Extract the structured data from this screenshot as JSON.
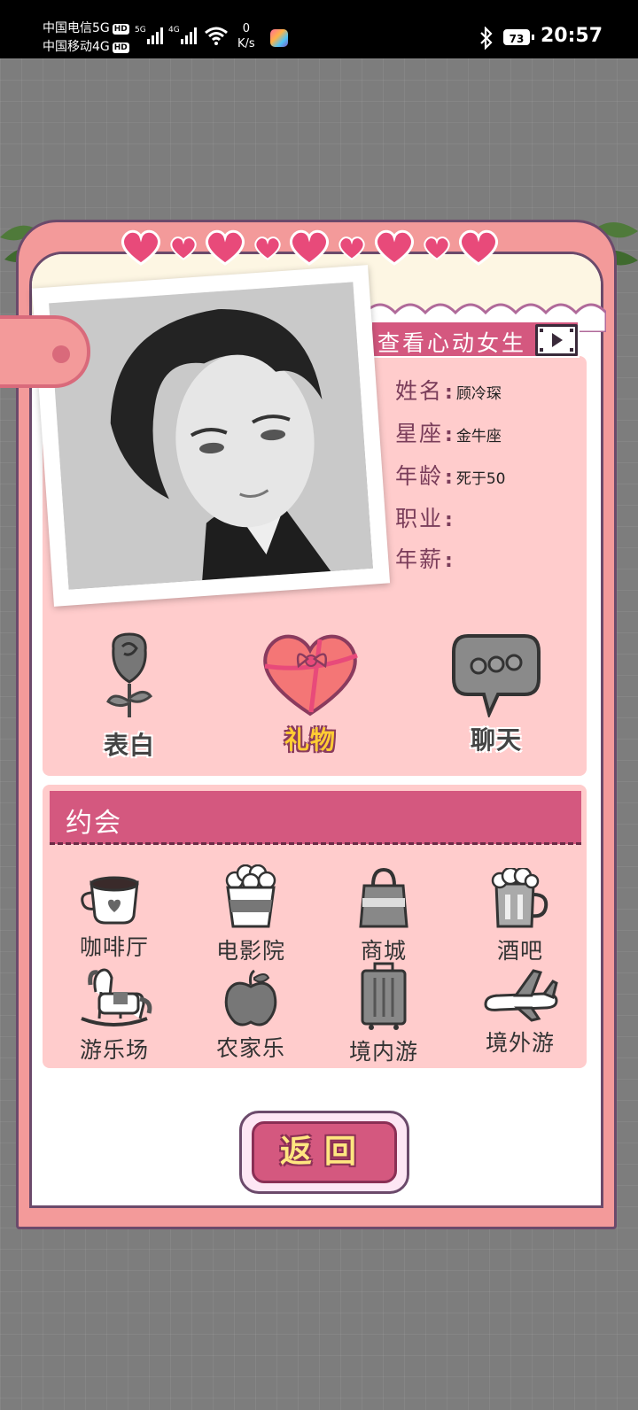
{
  "status_bar": {
    "carrier1": "中国电信5G",
    "carrier2": "中国移动4G",
    "hd": "HD",
    "net1": "5G",
    "net2": "4G",
    "speed_value": "0",
    "speed_unit": "K/s",
    "battery": "73",
    "time": "20:57"
  },
  "profile": {
    "view_title": "查看心动女生",
    "fields": [
      {
        "label": "姓名",
        "value": "顾冷琛"
      },
      {
        "label": "星座",
        "value": "金牛座"
      },
      {
        "label": "年龄",
        "value": "死于50"
      },
      {
        "label": "职业",
        "value": ""
      },
      {
        "label": "年薪",
        "value": ""
      }
    ]
  },
  "actions": [
    {
      "label": "表白",
      "icon": "rose-icon"
    },
    {
      "label": "礼物",
      "icon": "gift-heart-icon"
    },
    {
      "label": "聊天",
      "icon": "chat-bubble-icon"
    }
  ],
  "dating": {
    "title": "约会",
    "places": [
      {
        "label": "咖啡厅",
        "icon": "coffee-cup-icon"
      },
      {
        "label": "电影院",
        "icon": "popcorn-icon"
      },
      {
        "label": "商城",
        "icon": "shopping-bag-icon"
      },
      {
        "label": "酒吧",
        "icon": "beer-mug-icon"
      },
      {
        "label": "游乐场",
        "icon": "rocking-horse-icon"
      },
      {
        "label": "农家乐",
        "icon": "apple-icon"
      },
      {
        "label": "境内游",
        "icon": "suitcase-icon"
      },
      {
        "label": "境外游",
        "icon": "airplane-icon"
      }
    ]
  },
  "back_button": {
    "label": "返回"
  },
  "colors": {
    "card": "#f39a9a",
    "panel": "#ffcccc",
    "accent": "#d4587f",
    "heart": "#e84a7a"
  }
}
